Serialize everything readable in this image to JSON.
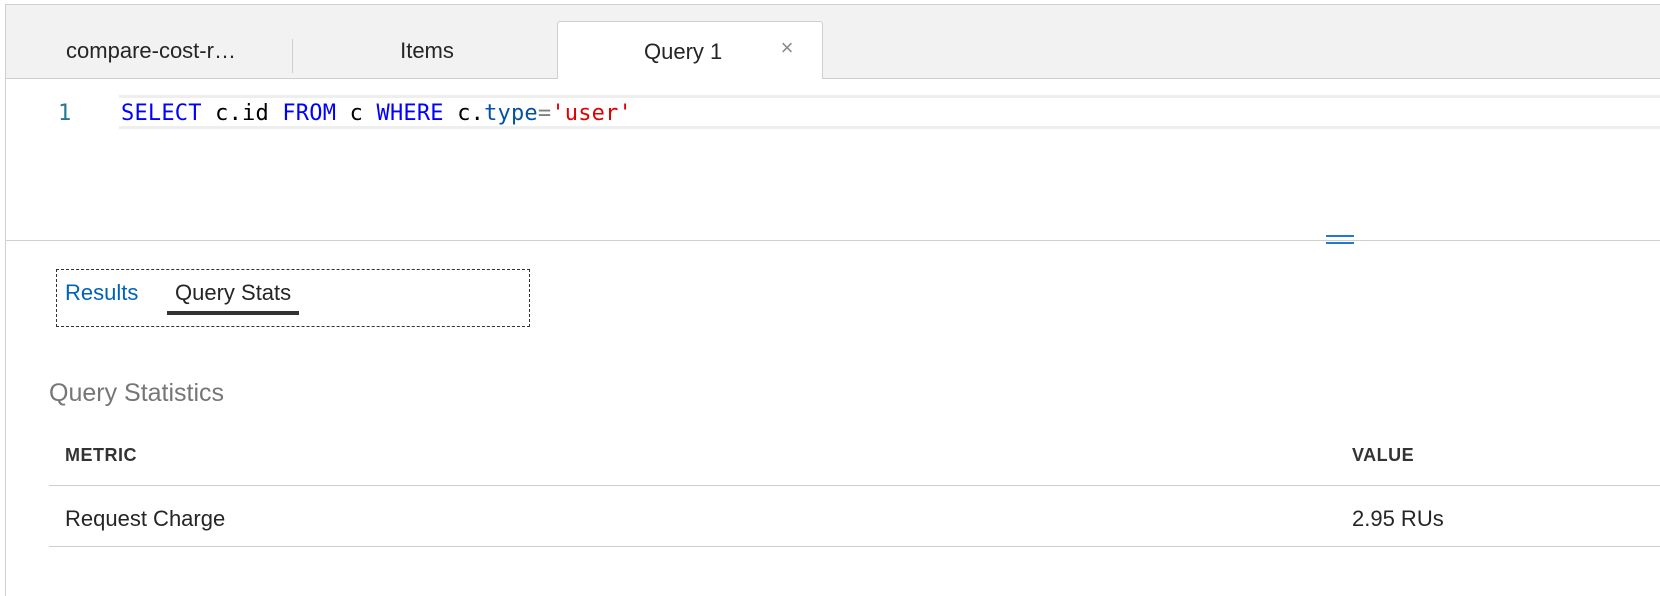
{
  "tabs": [
    {
      "label": "compare-cost-r…"
    },
    {
      "label": "Items"
    },
    {
      "label": "Query 1",
      "active": true,
      "close_icon": "×"
    }
  ],
  "editor": {
    "line_number": "1",
    "tokens": {
      "select": "SELECT",
      "cid": "c.id",
      "from": "FROM",
      "c": "c",
      "where": "WHERE",
      "c_dot": "c.",
      "type": "type",
      "eq": "=",
      "value": "'user'"
    }
  },
  "results_pane": {
    "tabs": [
      {
        "label": "Results"
      },
      {
        "label": "Query Stats",
        "selected": true
      }
    ],
    "section_title": "Query Statistics",
    "table": {
      "headers": {
        "metric": "METRIC",
        "value": "VALUE"
      },
      "rows": [
        {
          "metric": "Request Charge",
          "value": "2.95 RUs"
        }
      ]
    }
  },
  "colors": {
    "keyword": "#0000ff",
    "property": "#0451a5",
    "string": "#e00000",
    "link": "#0062b8",
    "line_number": "#237893"
  },
  "icons": {
    "tab_close": "close-icon",
    "splitter": "splitter-handle-icon"
  }
}
